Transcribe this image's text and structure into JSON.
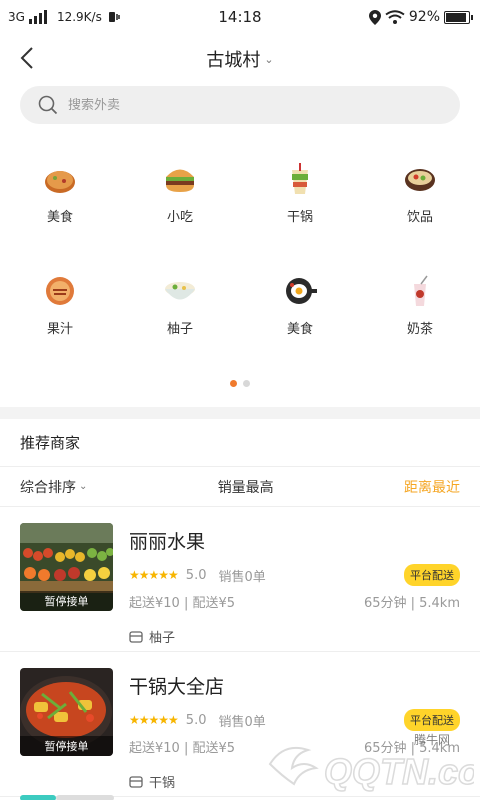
{
  "status_bar": {
    "network": "3G",
    "speed": "12.9K/s",
    "time": "14:18",
    "battery": "92%",
    "battery_level": 0.92
  },
  "header": {
    "title": "古城村"
  },
  "search": {
    "placeholder": "搜索外卖"
  },
  "categories": [
    {
      "label": "美食",
      "icon": "pancake-icon"
    },
    {
      "label": "小吃",
      "icon": "burger-icon"
    },
    {
      "label": "干锅",
      "icon": "drink-cup-icon"
    },
    {
      "label": "饮品",
      "icon": "pot-icon"
    },
    {
      "label": "果汁",
      "icon": "hotpot-icon"
    },
    {
      "label": "柚子",
      "icon": "noodle-bowl-icon"
    },
    {
      "label": "美食",
      "icon": "pan-egg-icon"
    },
    {
      "label": "奶茶",
      "icon": "milk-tea-icon"
    }
  ],
  "pagination": {
    "active": 1,
    "total": 2
  },
  "section": {
    "title": "推荐商家"
  },
  "sort": {
    "option1": "综合排序",
    "option2": "销量最高",
    "option3": "距离最近"
  },
  "stores": [
    {
      "name": "丽丽水果",
      "badge": "暂停接单",
      "stars": "★★★★★",
      "score": "5.0",
      "sales": "销售0单",
      "delivery_tag": "平台配送",
      "fees": "起送¥10 | 配送¥5",
      "eta": "65分钟 | 5.4km",
      "category": "柚子"
    },
    {
      "name": "干锅大全店",
      "badge": "暂停接单",
      "stars": "★★★★★",
      "score": "5.0",
      "sales": "销售0单",
      "delivery_tag": "平台配送",
      "fees": "起送¥10 | 配送¥5",
      "eta": "65分钟 | 5.4km",
      "category": "干锅"
    }
  ],
  "watermark": {
    "text": "腾牛网",
    "brand": "QQTN.com"
  },
  "colors": {
    "accent": "#f5a623",
    "tag": "#ffd42a",
    "star": "#f7b500",
    "dot_active": "#f07a2c"
  }
}
